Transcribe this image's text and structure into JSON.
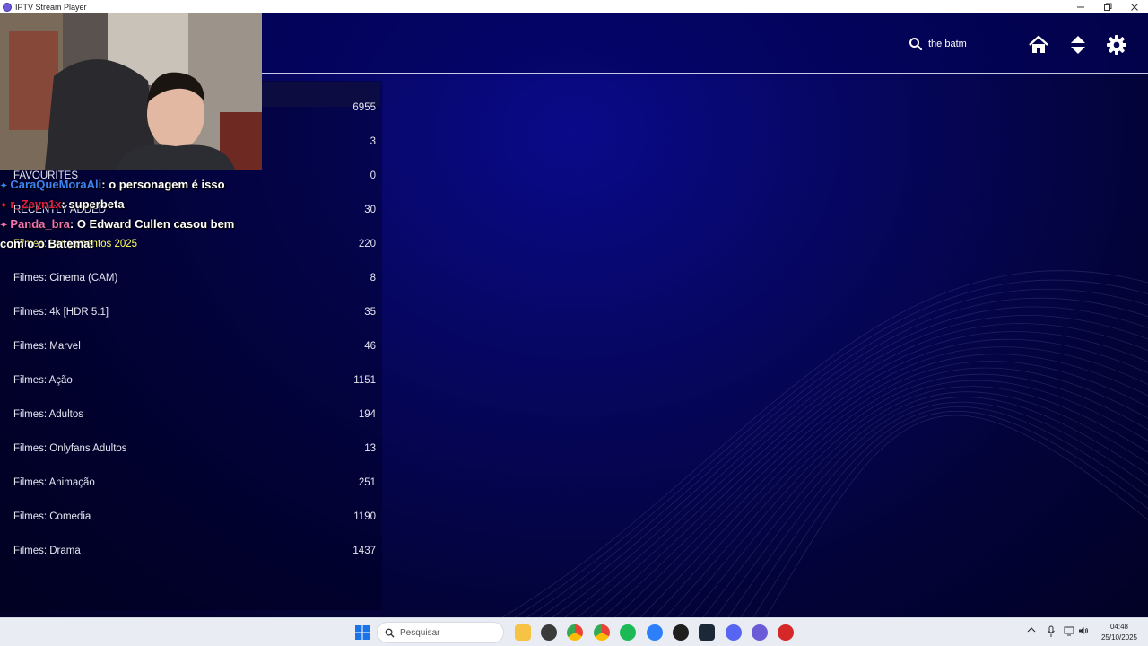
{
  "window": {
    "title": "IPTV Stream Player",
    "controls": [
      "minimize",
      "restore",
      "close"
    ]
  },
  "header": {
    "search": {
      "value": "the batm",
      "icon": "search-icon"
    },
    "icons": [
      "home-icon",
      "sort-icon",
      "gear-icon"
    ]
  },
  "categories": [
    {
      "label": "",
      "count": "6955"
    },
    {
      "label": "",
      "count": "3"
    },
    {
      "label": "FAVOURITES",
      "count": "0"
    },
    {
      "label": "RECENTLY ADDED",
      "count": "30"
    },
    {
      "label": "Filmes: Lançamentos 2025",
      "count": "220",
      "active": true
    },
    {
      "label": "Filmes: Cinema (CAM)",
      "count": "8"
    },
    {
      "label": "Filmes: 4k [HDR 5.1]",
      "count": "35"
    },
    {
      "label": "Filmes: Marvel",
      "count": "46"
    },
    {
      "label": "Filmes: Ação",
      "count": "1151"
    },
    {
      "label": "Filmes: Adultos",
      "count": "194"
    },
    {
      "label": "Filmes: Onlyfans Adultos",
      "count": "13"
    },
    {
      "label": "Filmes: Animação",
      "count": "251"
    },
    {
      "label": "Filmes: Comedia",
      "count": "1190"
    },
    {
      "label": "Filmes: Drama",
      "count": "1437"
    }
  ],
  "chat": [
    {
      "user": "CaraQueMoraAli",
      "user_color": "#3b82f6",
      "message": ": o personagem é isso"
    },
    {
      "user": "r_Zeyn1x",
      "user_color": "#e11d48",
      "message": ": superbeta"
    },
    {
      "user": "Panda_bra",
      "user_color": "#f472b6",
      "message": ": O Edward Cullen casou bem"
    },
    {
      "user": "",
      "user_color": "#ffffff",
      "message": "com o o Batema!"
    }
  ],
  "taskbar": {
    "search_placeholder": "Pesquisar",
    "clock": {
      "time": "04:48",
      "date": "25/10/2025"
    }
  },
  "colors": {
    "accent_active": "#ffff55",
    "background": "#060660",
    "text": "#e6e6f0"
  }
}
